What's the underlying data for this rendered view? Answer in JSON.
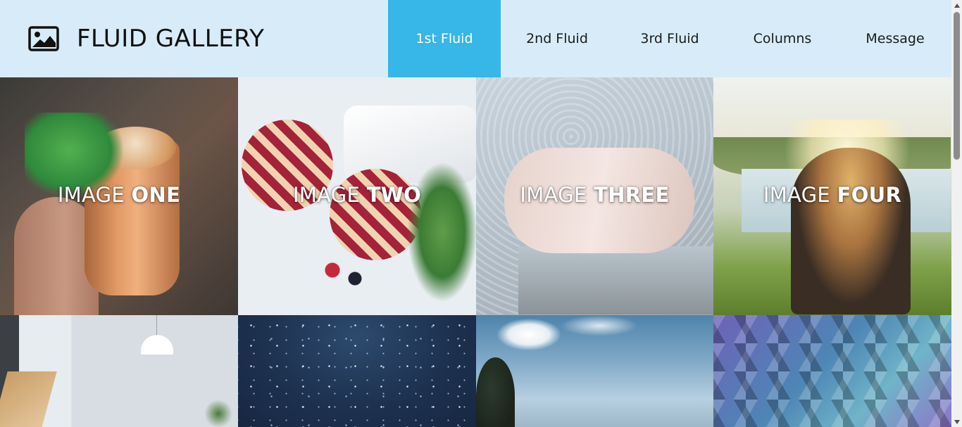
{
  "header": {
    "brand_icon": "image-icon",
    "title": "FLUID GALLERY"
  },
  "nav": {
    "items": [
      {
        "label": "1st Fluid",
        "active": true
      },
      {
        "label": "2nd Fluid",
        "active": false
      },
      {
        "label": "3rd Fluid",
        "active": false
      },
      {
        "label": "Columns",
        "active": false
      },
      {
        "label": "Message",
        "active": false
      }
    ],
    "active_color": "#37b6e8",
    "header_background": "#d7ecf8"
  },
  "gallery": {
    "tiles": [
      {
        "lead": "IMAGE",
        "name": "ONE"
      },
      {
        "lead": "IMAGE",
        "name": "TWO"
      },
      {
        "lead": "IMAGE",
        "name": "THREE"
      },
      {
        "lead": "IMAGE",
        "name": "FOUR"
      },
      {
        "lead": "",
        "name": ""
      },
      {
        "lead": "",
        "name": ""
      },
      {
        "lead": "",
        "name": ""
      },
      {
        "lead": "",
        "name": ""
      }
    ]
  }
}
